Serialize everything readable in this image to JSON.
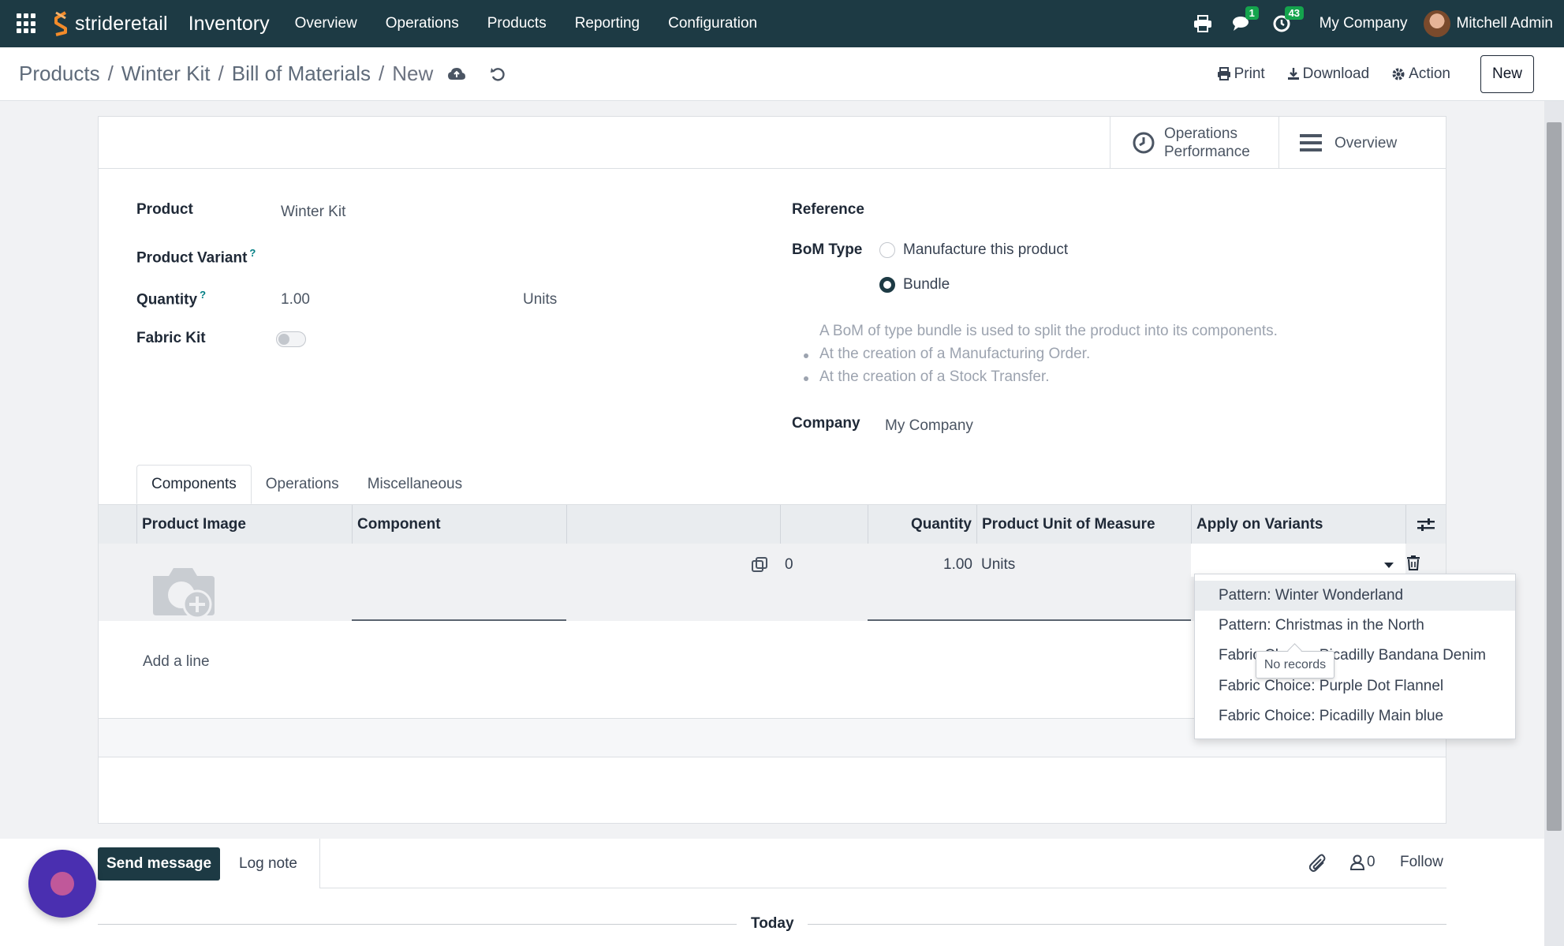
{
  "navbar": {
    "brand": "strideretail",
    "app_name": "Inventory",
    "menu": [
      "Overview",
      "Operations",
      "Products",
      "Reporting",
      "Configuration"
    ],
    "messages_badge": "1",
    "activities_badge": "43",
    "company": "My Company",
    "user": "Mitchell Admin"
  },
  "control": {
    "breadcrumb": [
      "Products",
      "Winter Kit",
      "Bill of Materials"
    ],
    "current": "New",
    "print": "Print",
    "download": "Download",
    "action": "Action",
    "new_button": "New"
  },
  "smart_buttons": {
    "operations_performance_line1": "Operations",
    "operations_performance_line2": "Performance",
    "overview": "Overview"
  },
  "form": {
    "product_label": "Product",
    "product_value": "Winter Kit",
    "variant_label": "Product Variant",
    "quantity_label": "Quantity",
    "quantity_value": "1.00",
    "quantity_uom": "Units",
    "fabric_kit_label": "Fabric Kit",
    "fabric_kit_on": false,
    "reference_label": "Reference",
    "bom_type_label": "BoM Type",
    "bom_type_options": [
      "Manufacture this product",
      "Bundle"
    ],
    "bom_type_selected": "Bundle",
    "help_intro": "A BoM of type bundle is used to split the product into its components.",
    "help_bullets": [
      "At the creation of a Manufacturing Order.",
      "At the creation of a Stock Transfer."
    ],
    "company_label": "Company",
    "company_value": "My Company",
    "help_marker": "?"
  },
  "tabs": [
    "Components",
    "Operations",
    "Miscellaneous"
  ],
  "table": {
    "headers": [
      "Product Image",
      "Component",
      "",
      "",
      "Quantity",
      "Product Unit of Measure",
      "Apply on Variants"
    ],
    "row": {
      "count": "0",
      "quantity": "1.00",
      "uom": "Units"
    },
    "add_line": "Add a line"
  },
  "dropdown": {
    "items": [
      "Pattern: Winter Wonderland",
      "Pattern: Christmas in the North",
      "Fabric Choice: Picadilly Bandana Denim",
      "Fabric Choice: Purple Dot Flannel",
      "Fabric Choice: Picadilly Main blue"
    ],
    "tooltip": "No records"
  },
  "chatter": {
    "send_message": "Send message",
    "log_note": "Log note",
    "followers_count": "0",
    "follow": "Follow",
    "today": "Today"
  },
  "colors": {
    "navbar": "#1d3a44",
    "accent": "#017e84",
    "badge": "#14a44d"
  }
}
